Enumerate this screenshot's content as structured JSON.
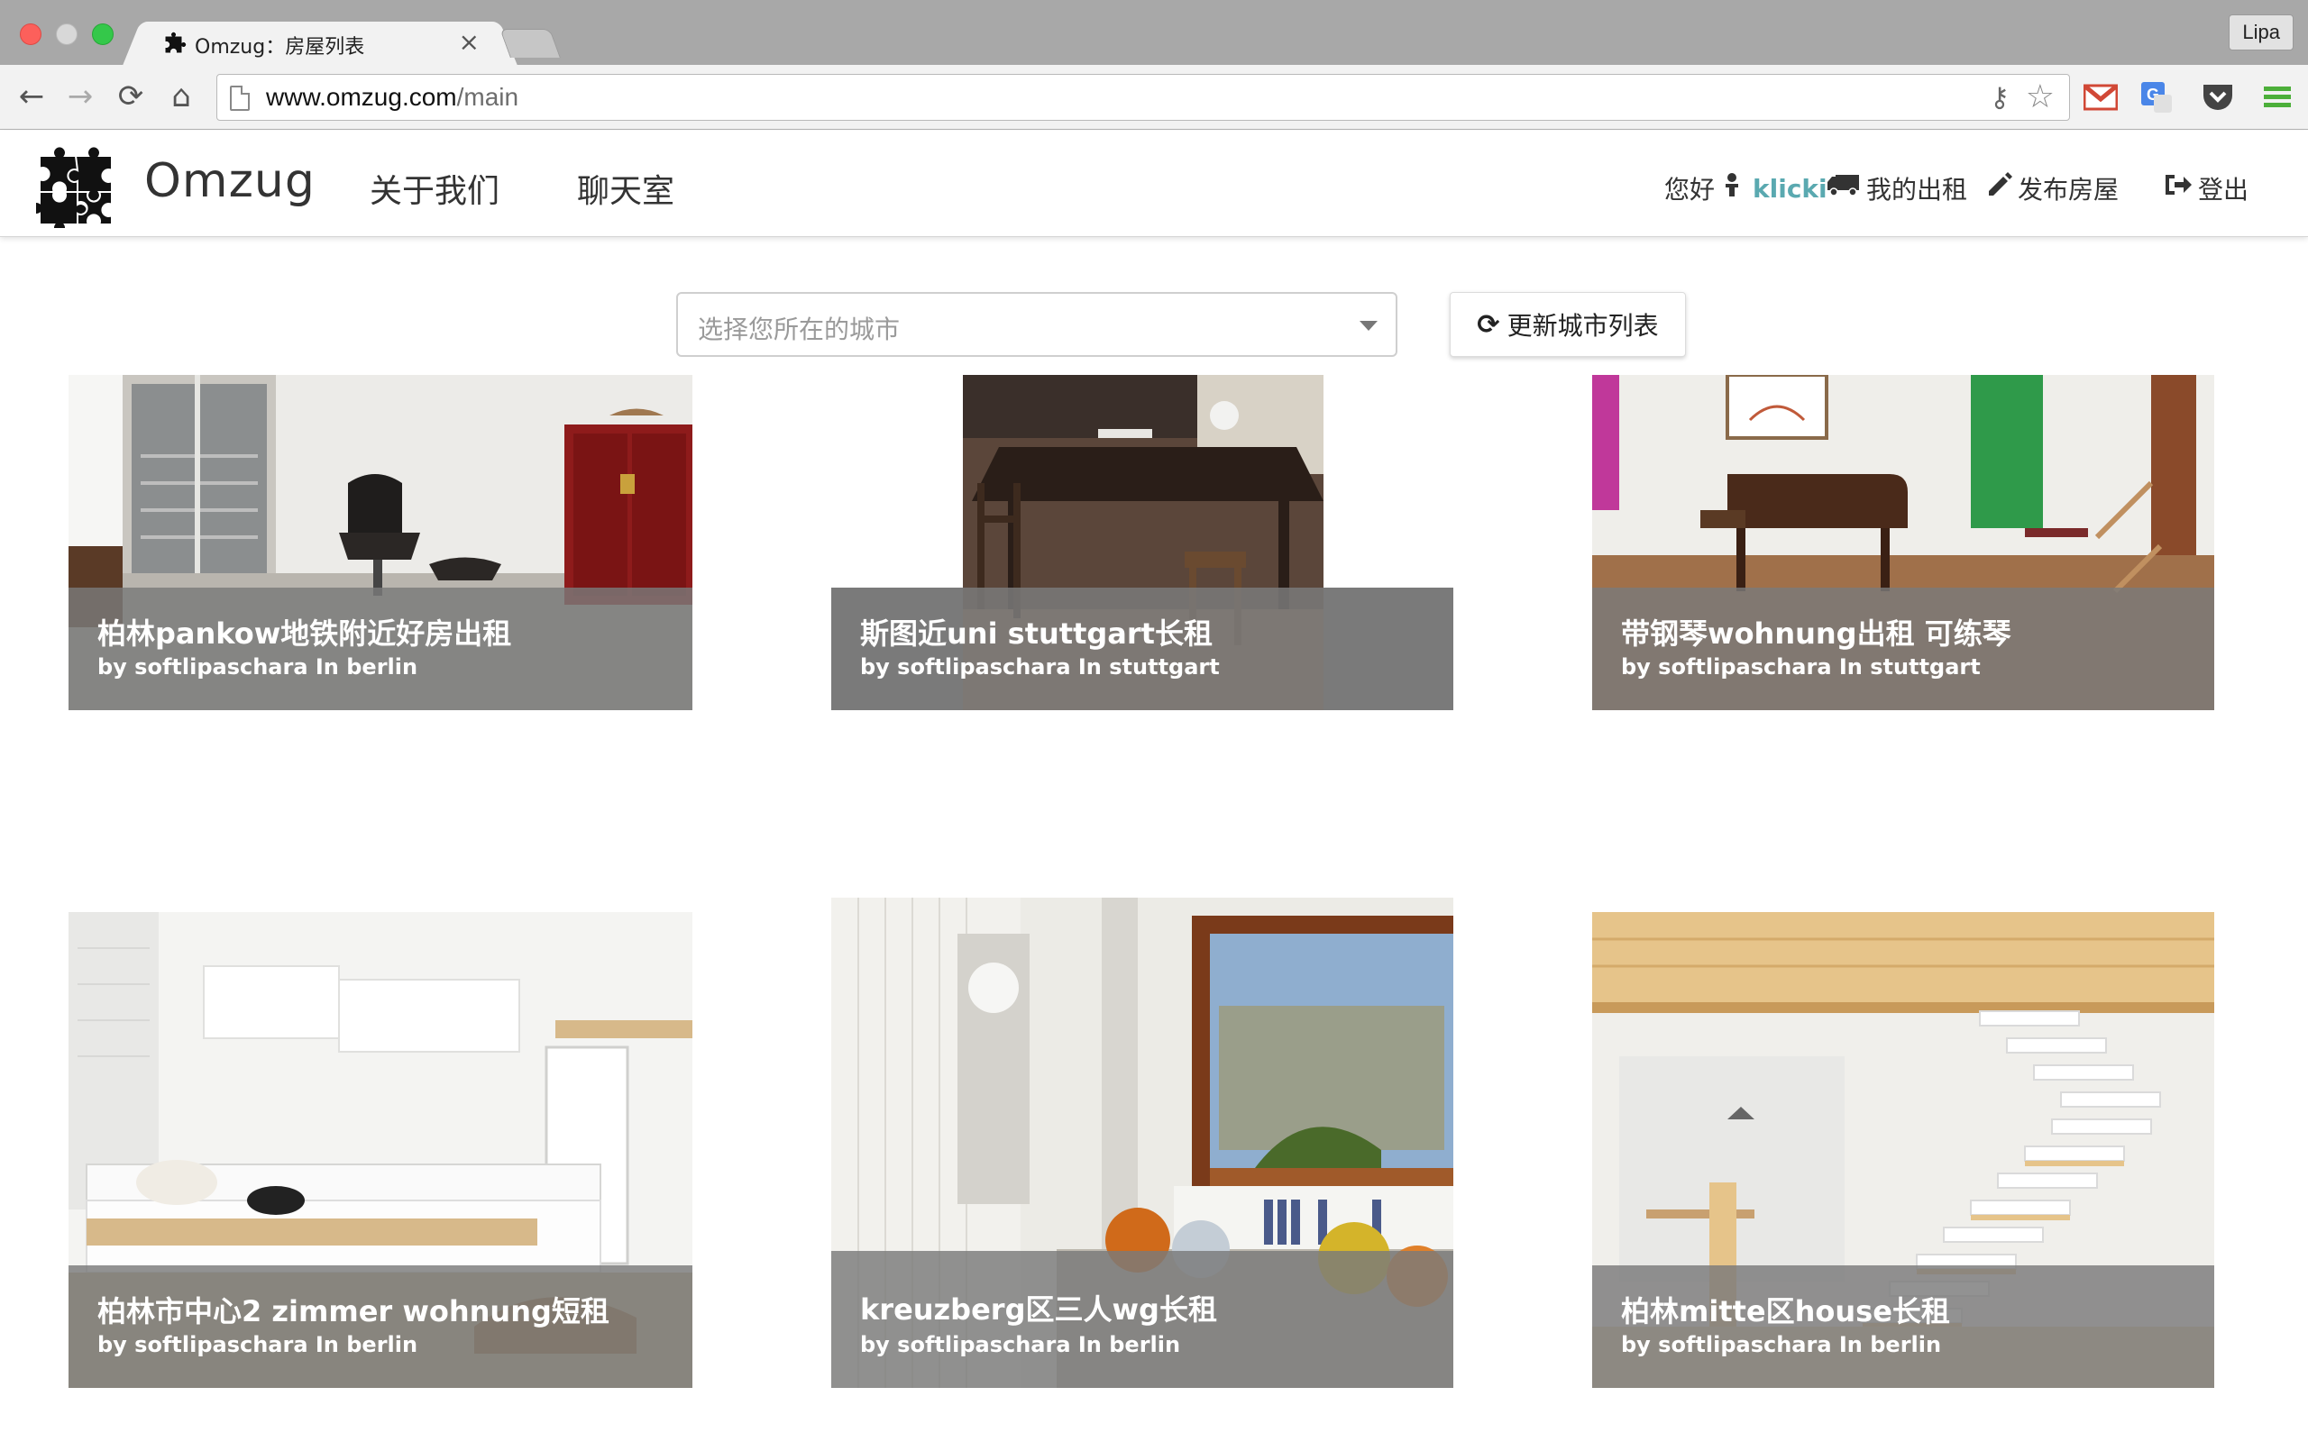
{
  "browser": {
    "tab_title": "Omzug：房屋列表",
    "tab_close": "×",
    "profile": "Lipa",
    "url_host": "www.omzug.com",
    "url_path": "/main",
    "buttons": {
      "back": "←",
      "forward": "→",
      "reload": "⟳",
      "home": "⌂"
    }
  },
  "site": {
    "brand": "Omzug",
    "nav": [
      {
        "label": "关于我们"
      },
      {
        "label": "聊天室"
      }
    ],
    "greeting": "您好",
    "username": "klicki",
    "my_rentals": "我的出租",
    "post_house": "发布房屋",
    "logout": "登出"
  },
  "controls": {
    "city_placeholder": "选择您所在的城市",
    "refresh_label": "更新城市列表"
  },
  "listings": [
    {
      "title": "柏林pankow地铁附近好房出租",
      "byline": "by softlipaschara In berlin",
      "image": "living-room-chair"
    },
    {
      "title": "斯图近uni stuttgart长租",
      "byline": "by softlipaschara In stuttgart",
      "image": "dining-table"
    },
    {
      "title": "带钢琴wohnung出租 可练琴",
      "byline": "by softlipaschara In stuttgart",
      "image": "piano-room"
    },
    {
      "title": "柏林市中心2 zimmer wohnung短租",
      "byline": "by softlipaschara In berlin",
      "image": "white-kitchen"
    },
    {
      "title": "kreuzberg区三人wg长租",
      "byline": "by softlipaschara In berlin",
      "image": "sofa-window"
    },
    {
      "title": "柏林mitte区house长租",
      "byline": "by softlipaschara In berlin",
      "image": "white-staircase"
    }
  ],
  "colors": {
    "accent_username": "#5aa9b0",
    "caption_bg": "#7a7a7a",
    "titlebar": "#a8a8a8",
    "gmail_red": "#d14836",
    "translate_blue": "#4a86e8",
    "menu_green": "#4caf3a"
  }
}
